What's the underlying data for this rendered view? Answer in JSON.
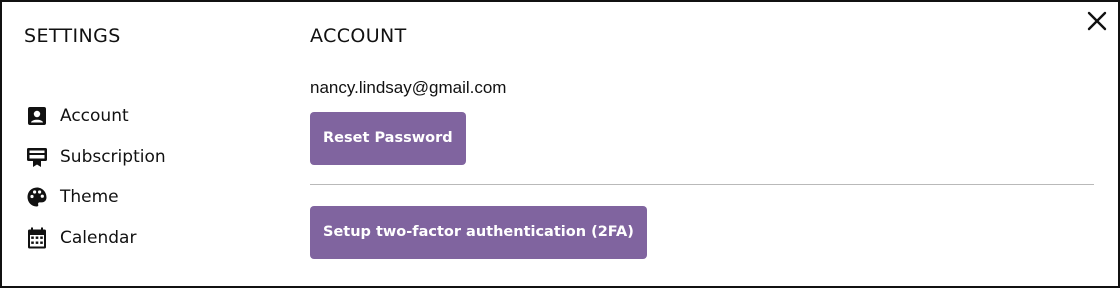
{
  "sidebar": {
    "title": "SETTINGS",
    "items": [
      {
        "label": "Account",
        "icon": "account-box-icon"
      },
      {
        "label": "Subscription",
        "icon": "subscription-card-icon"
      },
      {
        "label": "Theme",
        "icon": "palette-icon"
      },
      {
        "label": "Calendar",
        "icon": "calendar-icon"
      }
    ]
  },
  "main": {
    "title": "ACCOUNT",
    "email": "nancy.lindsay@gmail.com",
    "reset_password_label": "Reset Password",
    "setup_2fa_label": "Setup two-factor authentication (2FA)"
  },
  "close": {
    "icon": "close-icon"
  },
  "colors": {
    "accent": "#80649f",
    "divider": "#b9b9b9",
    "text": "#111111"
  }
}
